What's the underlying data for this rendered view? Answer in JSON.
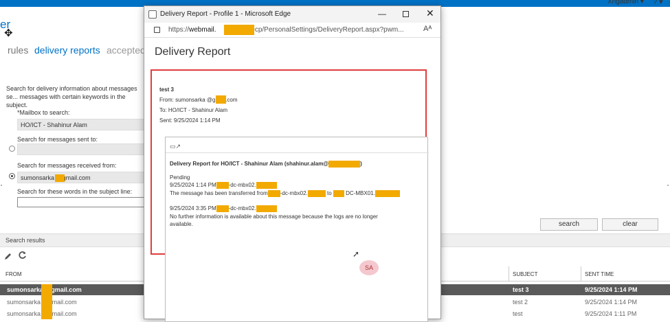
{
  "ecp": {
    "user": "Xngadmin ▾",
    "help": "? ▾",
    "app_title": "er",
    "nav": [
      "rules",
      "delivery reports",
      "accepted"
    ],
    "intro": "Search for delivery information about messages se... messages with certain keywords in the subject.",
    "mailbox_label": "*Mailbox to search:",
    "mailbox_value": "HO/ICT - Shahinur Alam",
    "sent_to_label": "Search for messages sent to:",
    "received_from_label": "Search for messages received from:",
    "received_from_value": "sumonsarka    @gmail.com",
    "subject_label": "Search for these words in the subject line:",
    "search_label": "search",
    "clear_label": "clear",
    "results_title": "Search results",
    "columns": {
      "from": "FROM",
      "subject": "SUBJECT",
      "sent_time": "SENT TIME"
    },
    "rows": [
      {
        "from": "sumonsarka    @gmail.com",
        "subject": "test 3",
        "sent_time": "9/25/2024 1:14 PM"
      },
      {
        "from": "sumonsarka    @gmail.com",
        "subject": "test 2",
        "sent_time": "9/25/2024 1:14 PM"
      },
      {
        "from": "sumonsarka    @gmail.com",
        "subject": "test",
        "sent_time": "9/25/2024 1:11 PM"
      }
    ]
  },
  "popup": {
    "window_title": "Delivery Report - Profile 1 - Microsoft Edge",
    "url_prefix": "https://",
    "url_host": "webmail.",
    "url_rest": "/ecp/PersonalSettings/DeliveryReport.aspx?pwm...",
    "heading": "Delivery Report",
    "subject": "test 3",
    "from": "From: sumonsarka    @gmail.com",
    "to": "To:     HO/ICT - Shahinur Alam",
    "sent": "Sent:  9/25/2024 1:14 PM",
    "detail_title": "Delivery Report for  HO/ICT - Shahinur Alam (shahinur.alam@",
    "detail_title_end": ")",
    "status": "Pending",
    "event1_time": "9/25/2024 1:14 PM",
    "event1_server": "-dc-mbx02.",
    "event1_text": "The message has been transferred from",
    "event1_from_server": "-dc-mbx02.",
    "event1_to": "to",
    "event1_to_server": "DC-MBX01.",
    "event2_time": "9/25/2024 3:35 PM",
    "event2_server": "-dc-mbx02.",
    "event2_text_1": "No further information is available about this message because the logs are no longer",
    "event2_text_2": "available.",
    "avatar": "SA"
  }
}
